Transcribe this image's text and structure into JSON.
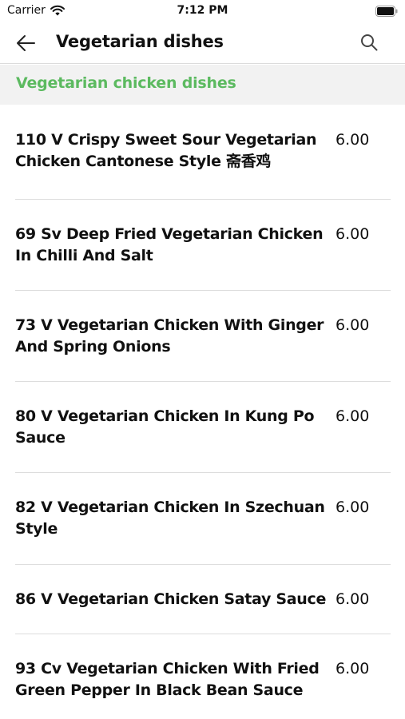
{
  "status_bar": {
    "carrier": "Carrier",
    "time": "7:12 PM"
  },
  "nav": {
    "title": "Vegetarian dishes",
    "back_icon": "arrow-left-icon",
    "search_icon": "search-icon"
  },
  "section": {
    "title": "Vegetarian chicken dishes",
    "accent_color": "#5cba60"
  },
  "items": [
    {
      "name": "110 V Crispy Sweet Sour Vegetarian Chicken Cantonese Style 斋香鸡",
      "price": "6.00"
    },
    {
      "name": "69 Sv Deep Fried Vegetarian Chicken In Chilli And Salt",
      "price": "6.00"
    },
    {
      "name": "73 V Vegetarian Chicken With Ginger And Spring Onions",
      "price": "6.00"
    },
    {
      "name": "80 V Vegetarian Chicken In Kung Po Sauce",
      "price": "6.00"
    },
    {
      "name": "82 V Vegetarian Chicken In Szechuan Style",
      "price": "6.00"
    },
    {
      "name": "86 V Vegetarian Chicken Satay Sauce",
      "price": "6.00"
    },
    {
      "name": "93 Cv Vegetarian Chicken With Fried Green Pepper In Black Bean Sauce",
      "price": "6.00"
    }
  ]
}
